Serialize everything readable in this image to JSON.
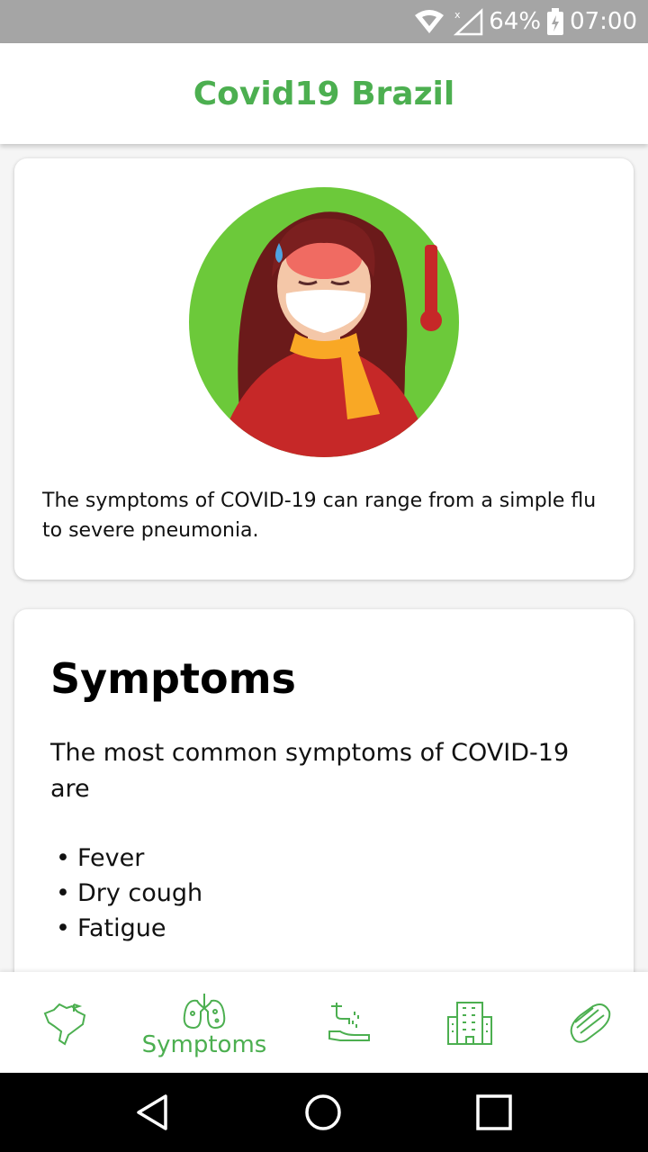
{
  "status_bar": {
    "battery": "64%",
    "time": "07:00",
    "icons": [
      "wifi-icon",
      "signal-icon",
      "battery-icon"
    ]
  },
  "app": {
    "title": "Covid19 Brazil",
    "accent_color": "#4caf50"
  },
  "intro_card": {
    "illustration": "sick-woman-mask-thermometer",
    "text": "The symptoms of COVID-19 can range from a simple flu to severe pneumonia."
  },
  "symptoms_card": {
    "heading": "Symptoms",
    "intro": "The most common symptoms of COVID-19 are",
    "items": [
      "Fever",
      "Dry cough",
      "Fatigue"
    ]
  },
  "bottom_nav": {
    "items": [
      {
        "icon": "brazil-map-icon",
        "label": ""
      },
      {
        "icon": "lungs-icon",
        "label": "Symptoms",
        "active": true
      },
      {
        "icon": "hand-washing-icon",
        "label": ""
      },
      {
        "icon": "hospital-icon",
        "label": ""
      },
      {
        "icon": "face-mask-icon",
        "label": ""
      }
    ]
  },
  "system_nav": {
    "buttons": [
      "back-icon",
      "home-icon",
      "recents-icon"
    ]
  }
}
